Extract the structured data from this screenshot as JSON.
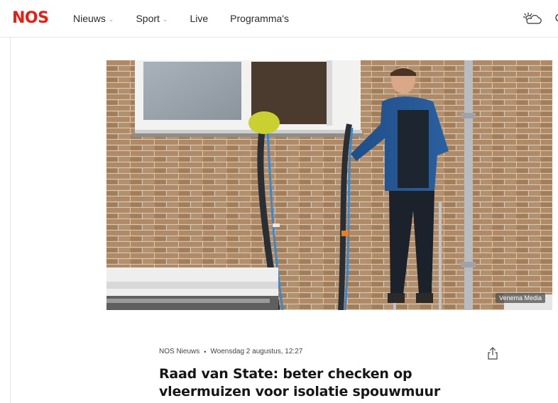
{
  "header": {
    "logo": "NOS",
    "nav": [
      {
        "label": "Nieuws",
        "has_dropdown": true
      },
      {
        "label": "Sport",
        "has_dropdown": true
      },
      {
        "label": "Live",
        "has_dropdown": false
      },
      {
        "label": "Programma's",
        "has_dropdown": false
      }
    ],
    "weather_icon": "partly-cloudy-icon"
  },
  "hero": {
    "credit": "Venema Media"
  },
  "article": {
    "source": "NOS Nieuws",
    "separator": "•",
    "date": "Woensdag 2 augustus, 12:27",
    "title": "Raad van State: beter checken op vleermuizen voor isolatie spouwmuur",
    "share_icon": "share-icon"
  },
  "colors": {
    "brand": "#e61e14",
    "text": "#1d1d1d",
    "muted": "#9a9a9a"
  }
}
